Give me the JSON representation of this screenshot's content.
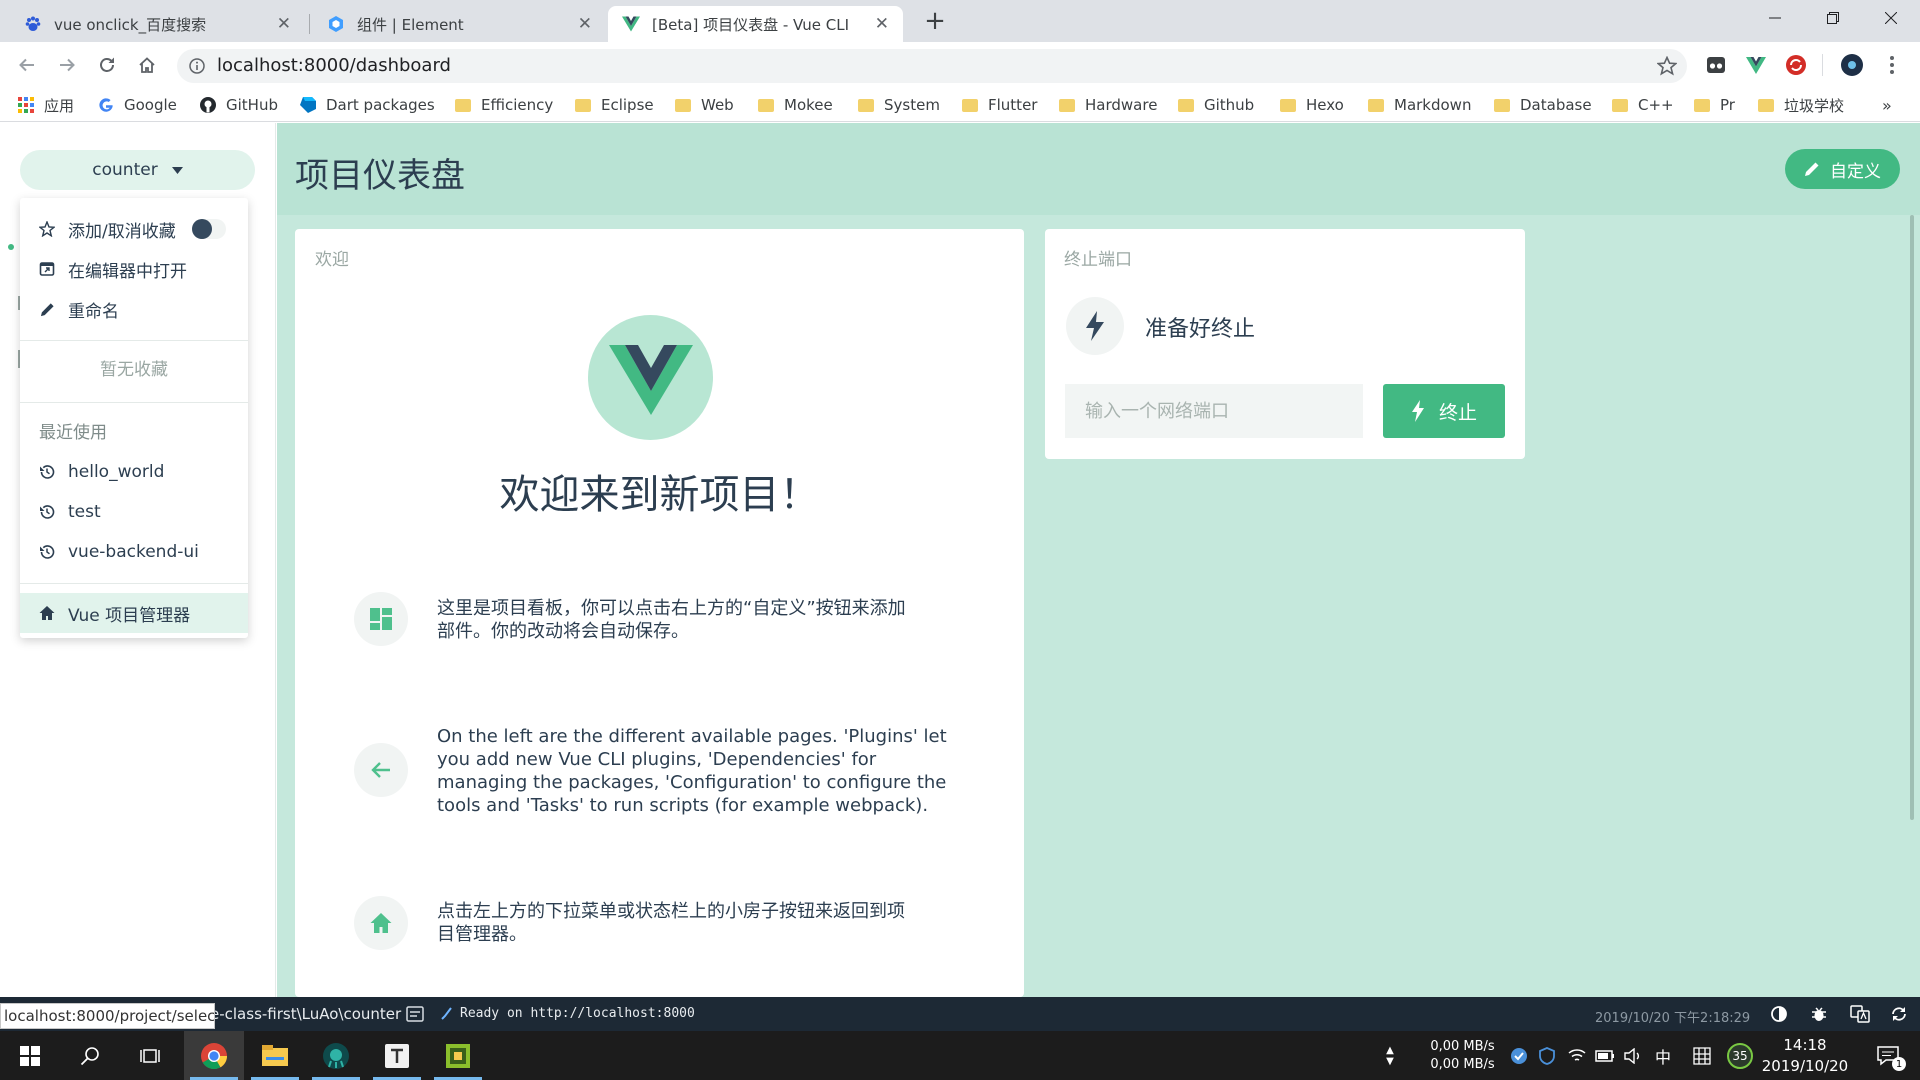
{
  "browser": {
    "tabs": [
      {
        "title": "vue onclick_百度搜索"
      },
      {
        "title": "组件 | Element"
      },
      {
        "title": "[Beta] 项目仪表盘 - Vue CLI"
      }
    ],
    "new_tab": "+",
    "url": "localhost:8000/dashboard",
    "bookmarks": [
      "应用",
      "Google",
      "GitHub",
      "Dart packages",
      "Efficiency",
      "Eclipse",
      "Web",
      "Mokee",
      "System",
      "Flutter",
      "Hardware",
      "Github",
      "Hexo",
      "Markdown",
      "Database",
      "C++",
      "Pr",
      "垃圾学校"
    ],
    "bookmarks_more": "»"
  },
  "sidebar": {
    "project_name": "counter",
    "menu": {
      "favorite": "添加/取消收藏",
      "open_editor": "在编辑器中打开",
      "rename": "重命名",
      "no_favorites": "暂无收藏",
      "recent_label": "最近使用",
      "recent": [
        "hello_world",
        "test",
        "vue-backend-ui"
      ],
      "manager": "Vue 项目管理器"
    }
  },
  "page": {
    "title": "项目仪表盘",
    "customize": "自定义"
  },
  "welcome": {
    "card_title": "欢迎",
    "heading": "欢迎来到新项目！",
    "tips": [
      {
        "lines": [
          "这里是项目看板，你可以点击右上方的“自定义”按钮来添加",
          "部件。你的改动将会自动保存。"
        ]
      },
      {
        "lines": [
          "On the left are the different available pages. 'Plugins' let",
          "you add new Vue CLI plugins, 'Dependencies' for",
          "managing the packages, 'Configuration' to configure the",
          "tools and 'Tasks' to run scripts (for example webpack)."
        ]
      },
      {
        "lines": [
          "点击左上方的下拉菜单或状态栏上的小房子按钮来返回到项",
          "目管理器。"
        ]
      }
    ]
  },
  "kill_port": {
    "card_title": "终止端口",
    "status": "准备好终止",
    "placeholder": "输入一个网络端口",
    "button": "终止"
  },
  "statusbar": {
    "hover_url": "localhost:8000/project/select",
    "path": "e-class-first\\LuAo\\counter",
    "log": "Ready on http://localhost:8000",
    "timestamp": "2019/10/20 下午2:18:29"
  },
  "taskbar": {
    "net_up": "0,00 MB/s",
    "net_down": "0,00 MB/s",
    "ime": "中",
    "badge": "35",
    "time": "14:18",
    "date": "2019/10/20",
    "notifications": "1"
  },
  "colors": {
    "accent": "#42b983",
    "main_bg": "#c5e8dc",
    "header_bg": "#b9e3d4",
    "statusbar_bg": "#1d2935",
    "vue_dark": "#35495e"
  }
}
